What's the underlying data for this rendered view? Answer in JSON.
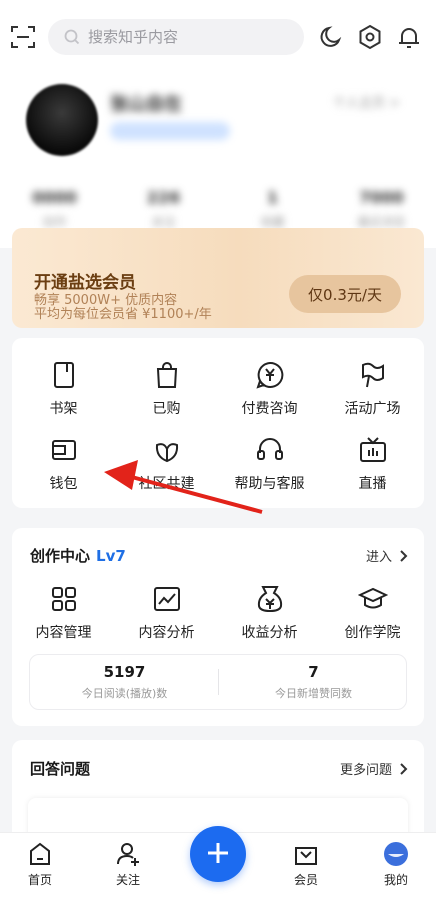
{
  "search": {
    "placeholder": "搜索知乎内容"
  },
  "profile": {
    "name": "张山自在",
    "home_link": "个人主页 >",
    "stats": [
      {
        "num": "0000",
        "label": "创作"
      },
      {
        "num": "226",
        "label": "关注"
      },
      {
        "num": "1",
        "label": "收藏"
      },
      {
        "num": "7000",
        "label": "最近浏览"
      }
    ]
  },
  "vip": {
    "title": "开通盐选会员",
    "subtitle_1": "畅享 5000W+ 优质内容",
    "subtitle_2": "平均为每位会员省 ¥1100+/年",
    "button": "仅0.3元/天"
  },
  "quick_menu": [
    {
      "label": "书架",
      "icon": "bookshelf-icon"
    },
    {
      "label": "已购",
      "icon": "shopping-bag-icon"
    },
    {
      "label": "付费咨询",
      "icon": "paid-consult-icon"
    },
    {
      "label": "活动广场",
      "icon": "flag-icon"
    },
    {
      "label": "钱包",
      "icon": "wallet-icon"
    },
    {
      "label": "社区共建",
      "icon": "community-icon"
    },
    {
      "label": "帮助与客服",
      "icon": "headset-icon"
    },
    {
      "label": "直播",
      "icon": "tv-icon"
    }
  ],
  "creator": {
    "title": "创作中心",
    "level": "Lv7",
    "enter": "进入",
    "items": [
      {
        "label": "内容管理",
        "icon": "grid-icon"
      },
      {
        "label": "内容分析",
        "icon": "chart-icon"
      },
      {
        "label": "收益分析",
        "icon": "money-bag-icon"
      },
      {
        "label": "创作学院",
        "icon": "graduation-cap-icon"
      }
    ],
    "today_reads_value": "5197",
    "today_reads_label": "今日阅读(播放)数",
    "today_likes_value": "7",
    "today_likes_label": "今日新增赞同数"
  },
  "answer": {
    "title": "回答问题",
    "more": "更多问题"
  },
  "tabbar": {
    "home": "首页",
    "follow": "关注",
    "vip": "会员",
    "me": "我的"
  },
  "colors": {
    "accent": "#1c6bf0",
    "vip_bg": "#f6dcbd",
    "annotation_arrow": "#e2231a"
  }
}
